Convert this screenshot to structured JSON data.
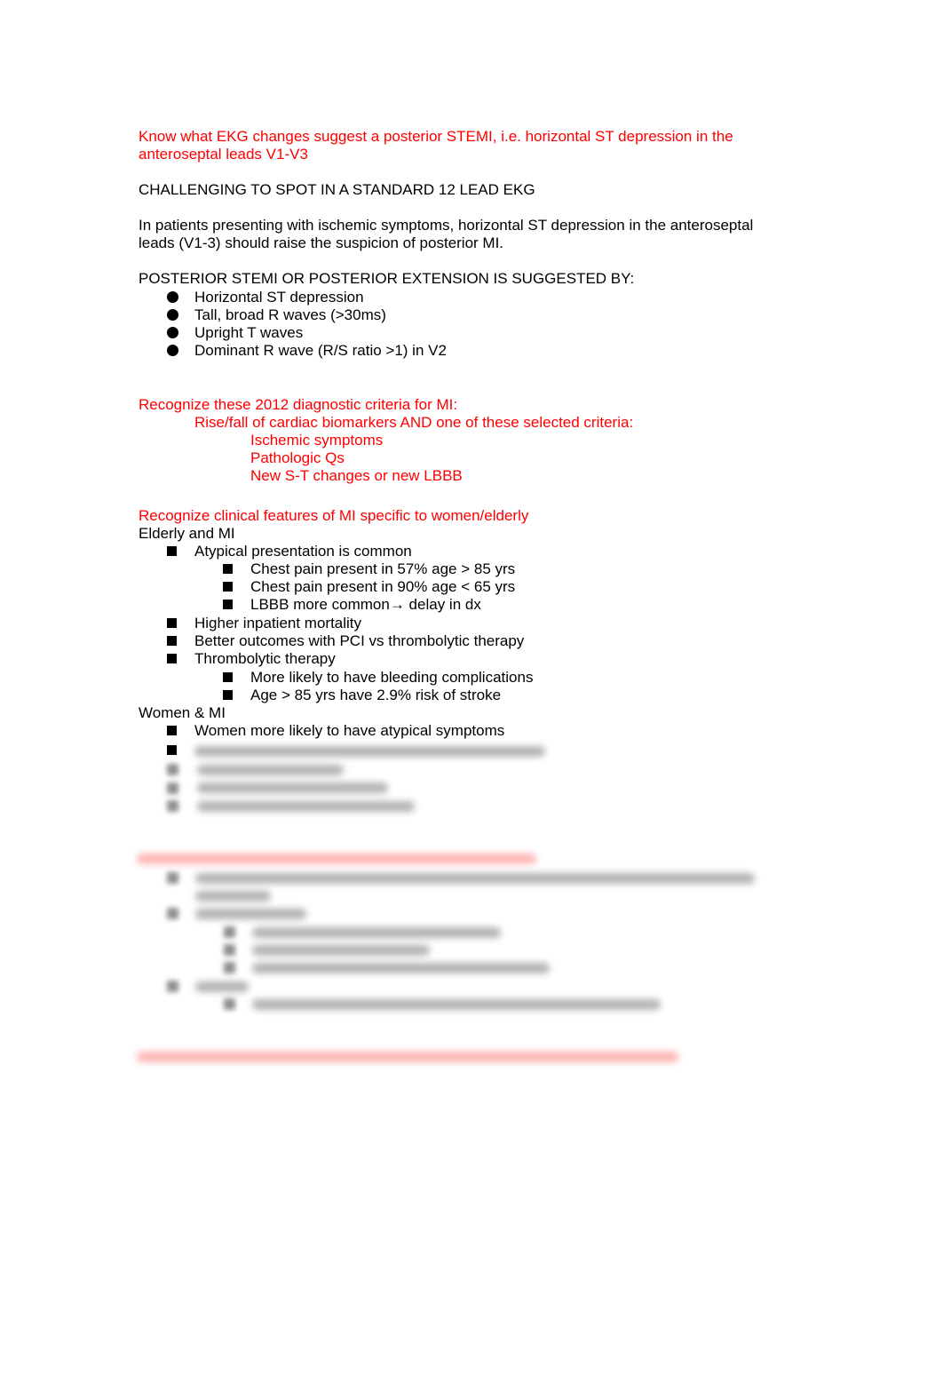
{
  "document": {
    "sections": {
      "posterior_stemi": {
        "objective_line1": "Know what EKG changes suggest a posterior STEMI, i.e. horizontal ST depression in the",
        "objective_line2": "anteroseptal leads V1-V3",
        "challenge_heading": "CHALLENGING TO SPOT IN A STANDARD 12 LEAD EKG",
        "para_line1": "In patients presenting with ischemic symptoms, horizontal ST depression in the anteroseptal",
        "para_line2": "leads (V1-3) should raise the suspicion of posterior MI.",
        "suggested_by_heading": "POSTERIOR STEMI OR POSTERIOR EXTENSION IS SUGGESTED BY:",
        "bullets": [
          "Horizontal ST depression",
          "Tall, broad R waves (>30ms)",
          "Upright T waves",
          "Dominant R wave (R/S ratio >1) in V2"
        ]
      },
      "diagnostic_criteria": {
        "objective": "Recognize these 2012 diagnostic criteria for MI:",
        "subheading": "Rise/fall of cardiac biomarkers AND one of these selected criteria:",
        "criteria": [
          "Ischemic symptoms",
          "Pathologic Qs",
          "New S-T changes or new LBBB"
        ]
      },
      "women_elderly": {
        "objective": "Recognize clinical features of MI specific to women/elderly",
        "elderly_heading": "Elderly and MI",
        "elderly_items": [
          {
            "text": "Atypical presentation is common",
            "children": [
              "Chest pain present in 57% age > 85 yrs",
              "Chest pain present in 90% age < 65 yrs",
              "LBBB more common→ delay in dx"
            ]
          },
          {
            "text": "Higher inpatient mortality",
            "children": []
          },
          {
            "text": "Better outcomes with PCI vs thrombolytic therapy",
            "children": []
          },
          {
            "text": "Thrombolytic therapy",
            "children": [
              "More likely to have bleeding complications",
              "Age > 85 yrs have 2.9% risk of stroke"
            ]
          }
        ],
        "women_heading": "Women & MI",
        "women_items": [
          "Women more likely to have atypical symptoms"
        ]
      }
    },
    "colors": {
      "objective_red": "#ff0000",
      "body_text": "#000000",
      "background": "#ffffff"
    }
  }
}
